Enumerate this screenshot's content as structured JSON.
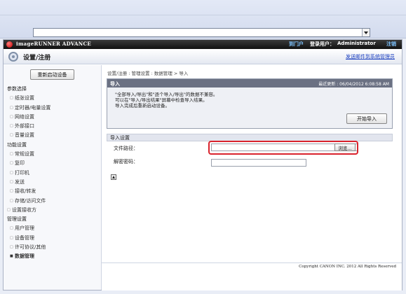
{
  "brand": {
    "name": "imageRUNNER ADVANCE",
    "portal_label": "到门户",
    "login_label": "登录用户：",
    "user_name": "Administrator",
    "logout_label": "注销"
  },
  "page": {
    "title": "设置/注册",
    "mail_link": "发送邮件到系统管理员"
  },
  "sidebar": {
    "restart_label": "重新启动设备",
    "nav": [
      {
        "type": "section",
        "label": "参数选择"
      },
      {
        "type": "item",
        "label": "纸张设置"
      },
      {
        "type": "item",
        "label": "定时器/电量设置"
      },
      {
        "type": "item",
        "label": "网络设置"
      },
      {
        "type": "item",
        "label": "外部接口"
      },
      {
        "type": "item",
        "label": "音量设置"
      },
      {
        "type": "section",
        "label": "功能设置"
      },
      {
        "type": "item",
        "label": "常规设置"
      },
      {
        "type": "item",
        "label": "复印"
      },
      {
        "type": "item",
        "label": "打印机"
      },
      {
        "type": "item",
        "label": "发送"
      },
      {
        "type": "item",
        "label": "接收/转发"
      },
      {
        "type": "item",
        "label": "存储/访问文件"
      },
      {
        "type": "top",
        "label": "设置接收方"
      },
      {
        "type": "section",
        "label": "管理设置"
      },
      {
        "type": "item",
        "label": "用户管理"
      },
      {
        "type": "item",
        "label": "设备管理"
      },
      {
        "type": "item",
        "label": "许可协议/其他"
      },
      {
        "type": "active",
        "label": "数据管理"
      }
    ]
  },
  "main": {
    "breadcrumb": "设置/注册 : 管理设置 : 数据管理 > 导入",
    "import_box": {
      "title": "导入",
      "last_update": "最近更新 : 06/04/2012 6:08:58 AM",
      "desc_line1": "\"全部导入/导出\"和\"逐个导入/导出\"的数据不兼容。",
      "desc_line2": "可以在\"导入/导出结果\"屏幕中检查导入结果。",
      "desc_line3": "导入完成后重新启动设备。",
      "start_label": "开始导入"
    },
    "settings": {
      "title": "导入设置",
      "file_path_label": "文件路径：",
      "browse_label": "浏览...",
      "password_label": "解密密码："
    }
  },
  "footer": {
    "copyright": "Copyright CANON INC. 2012 All Rights Reserved"
  },
  "colors": {
    "highlight": "#d9232d",
    "link": "#1a3fbf",
    "header_bar": "#6b7183"
  }
}
